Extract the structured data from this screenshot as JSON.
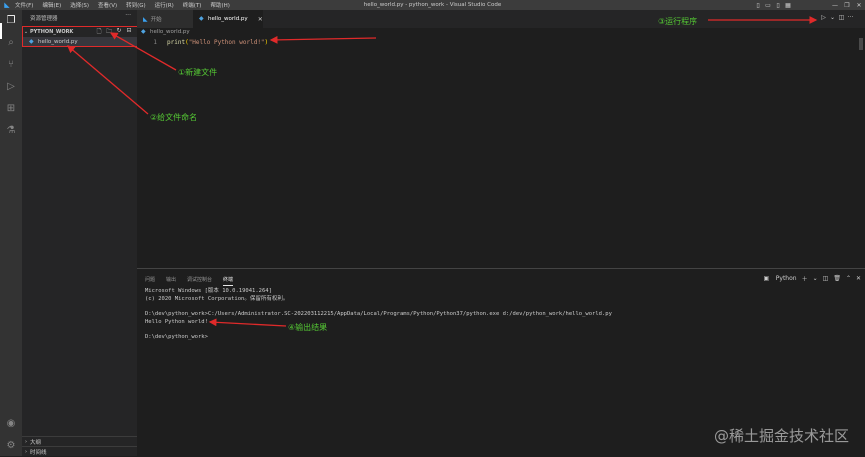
{
  "titlebar": {
    "menu": [
      "文件(F)",
      "编辑(E)",
      "选择(S)",
      "查看(V)",
      "转到(G)",
      "运行(R)",
      "终端(T)",
      "帮助(H)"
    ],
    "window_title": "hello_world.py - python_work - Visual Studio Code"
  },
  "activity_bar": {
    "items": [
      "explorer-icon",
      "search-icon",
      "source-control-icon",
      "run-debug-icon",
      "extensions-icon",
      "testing-icon"
    ],
    "bottom": [
      "account-icon",
      "settings-gear-icon"
    ]
  },
  "sidebar": {
    "title": "资源管理器",
    "folder": "PYTHON_WORK",
    "file": "hello_world.py",
    "sections": [
      "大纲",
      "时间线"
    ]
  },
  "tabs": [
    {
      "label": "开始"
    },
    {
      "label": "hello_world.py"
    }
  ],
  "editor": {
    "breadcrumb": "hello_world.py",
    "line_number": "1",
    "code": {
      "fn": "print",
      "open": "(",
      "str": "\"Hello Python world!\"",
      "close": ")"
    }
  },
  "panel": {
    "tabs": [
      "问题",
      "输出",
      "调试控制台",
      "终端"
    ],
    "shell": "Python",
    "terminal": [
      "Microsoft Windows [版本 10.0.19041.264]",
      "(c) 2020 Microsoft Corporation。保留所有权利。",
      "",
      "D:\\dev\\python_work>C:/Users/Administrator.SC-202203112215/AppData/Local/Programs/Python/Python37/python.exe d:/dev/python_work/hello_world.py",
      "Hello Python world!",
      "",
      "D:\\dev\\python_work>"
    ]
  },
  "annotations": {
    "new_file": "①新建文件",
    "name_file": "②给文件命名",
    "run": "③运行程序",
    "result": "④输出结果"
  },
  "watermark": "@稀土掘金技术社区",
  "colors": {
    "accent": "#007acc",
    "annotation": "#55c934",
    "arrow": "#e02a2a"
  }
}
